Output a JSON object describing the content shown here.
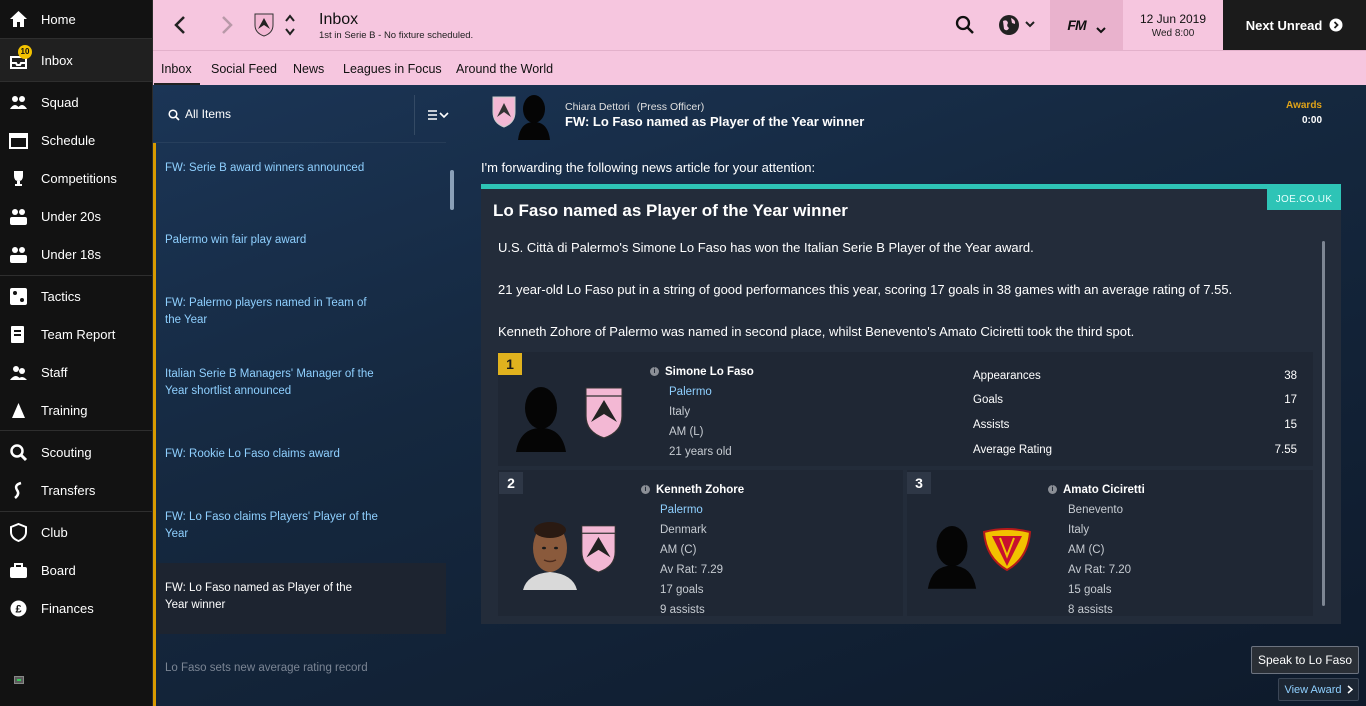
{
  "sidebar": {
    "items": [
      {
        "label": "Home",
        "icon": "home-icon"
      },
      {
        "label": "Inbox",
        "icon": "inbox-icon",
        "badge": "10"
      },
      {
        "label": "Squad",
        "icon": "squad-icon"
      },
      {
        "label": "Schedule",
        "icon": "schedule-icon"
      },
      {
        "label": "Competitions",
        "icon": "trophy-icon"
      },
      {
        "label": "Under 20s",
        "icon": "under20-icon"
      },
      {
        "label": "Under 18s",
        "icon": "under18-icon"
      },
      {
        "label": "Tactics",
        "icon": "tactics-icon"
      },
      {
        "label": "Team Report",
        "icon": "team-report-icon"
      },
      {
        "label": "Staff",
        "icon": "staff-icon"
      },
      {
        "label": "Training",
        "icon": "training-icon"
      },
      {
        "label": "Scouting",
        "icon": "scouting-icon"
      },
      {
        "label": "Transfers",
        "icon": "transfers-icon"
      },
      {
        "label": "Club",
        "icon": "club-icon"
      },
      {
        "label": "Board",
        "icon": "board-icon"
      },
      {
        "label": "Finances",
        "icon": "finances-icon"
      }
    ]
  },
  "header": {
    "title": "Inbox",
    "subtitle": "1st in Serie B - No fixture scheduled.",
    "date": "12 Jun 2019",
    "time": "Wed 8:00",
    "fm_label": "FM",
    "next_unread": "Next Unread"
  },
  "tabs": [
    "Inbox",
    "Social Feed",
    "News",
    "Leagues in Focus",
    "Around the World"
  ],
  "list": {
    "filter_label": "All Items",
    "messages": [
      "FW: Serie B award winners announced",
      "Palermo win fair play award",
      "FW: Palermo players named in Team of the Year",
      "Italian Serie B Managers' Manager of the Year shortlist announced",
      "FW: Rookie Lo Faso claims award",
      "FW: Lo Faso claims Players' Player of the Year",
      "FW: Lo Faso named as Player of the Year winner",
      "Lo Faso sets new average rating record"
    ]
  },
  "message": {
    "sender": "Chiara Dettori",
    "sender_role": "(Press Officer)",
    "subject": "FW: Lo Faso named as Player of the Year winner",
    "category": "Awards",
    "time": "0:00",
    "intro": "I'm forwarding the following news article for your attention:"
  },
  "article": {
    "source": "JOE.CO.UK",
    "title": "Lo Faso named as Player of the Year winner",
    "p1": "U.S. Città di Palermo's Simone Lo Faso has won the Italian Serie B Player of the Year award.",
    "p2": "21 year-old Lo Faso put in a string of good performances this year, scoring 17 goals in 38 games with an average rating of 7.55.",
    "p3": "Kenneth Zohore of Palermo was named in second place, whilst Benevento's Amato Ciciretti took the third spot.",
    "winner": {
      "rank": "1",
      "name": "Simone Lo Faso",
      "club": "Palermo",
      "nation": "Italy",
      "position": "AM (L)",
      "age": "21 years old",
      "stats": [
        {
          "label": "Appearances",
          "value": "38"
        },
        {
          "label": "Goals",
          "value": "17"
        },
        {
          "label": "Assists",
          "value": "15"
        },
        {
          "label": "Average Rating",
          "value": "7.55"
        }
      ]
    },
    "second": {
      "rank": "2",
      "name": "Kenneth Zohore",
      "club": "Palermo",
      "nation": "Denmark",
      "position": "AM (C)",
      "av_rat": "Av Rat: 7.29",
      "goals": "17 goals",
      "assists": "9 assists"
    },
    "third": {
      "rank": "3",
      "name": "Amato Ciciretti",
      "club": "Benevento",
      "nation": "Italy",
      "position": "AM (C)",
      "av_rat": "Av Rat: 7.20",
      "goals": "15 goals",
      "assists": "8 assists"
    }
  },
  "actions": {
    "speak": "Speak to Lo Faso",
    "view_award": "View Award"
  },
  "colors": {
    "topbar": "#f6c6df",
    "accent_teal": "#2ec4b6",
    "gold": "#f2c200",
    "link_blue": "#8fd0ff"
  }
}
